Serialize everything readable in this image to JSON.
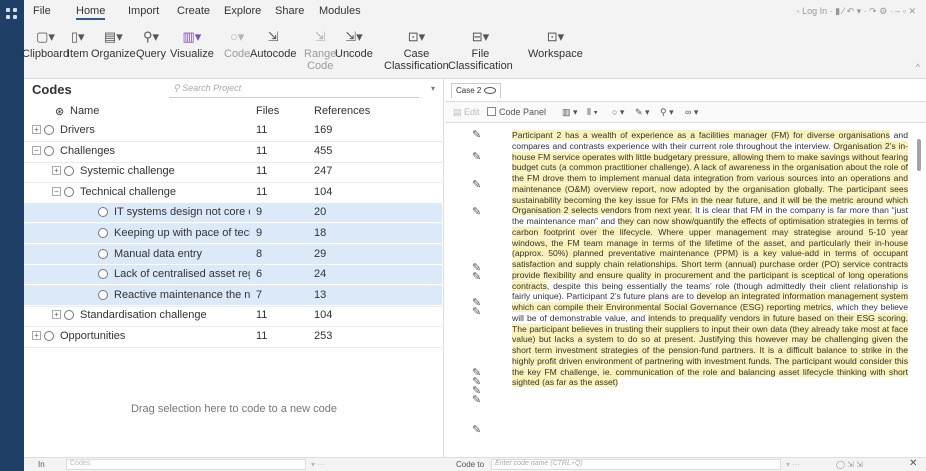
{
  "ribbon": {
    "tabs": [
      "File",
      "Home",
      "Import",
      "Create",
      "Explore",
      "Share",
      "Modules"
    ],
    "active_tab": "Home",
    "right_info": "Log In",
    "tools": [
      {
        "label": "Clipboard",
        "icon": "clipboard-icon"
      },
      {
        "label": "Item",
        "icon": "item-icon"
      },
      {
        "label": "Organize",
        "icon": "organize-icon"
      },
      {
        "label": "Query",
        "icon": "query-icon"
      },
      {
        "label": "Visualize",
        "icon": "chart-icon"
      },
      {
        "label": "Code",
        "icon": "code-icon"
      },
      {
        "label": "Autocode",
        "icon": "autocode-icon"
      },
      {
        "label": "Range",
        "label2": "Code",
        "icon": "range-code-icon"
      },
      {
        "label": "Uncode",
        "icon": "uncode-icon"
      },
      {
        "label": "Case",
        "label2": "Classification",
        "icon": "case-classification-icon"
      },
      {
        "label": "File",
        "label2": "Classification",
        "icon": "file-classification-icon"
      },
      {
        "label": "Workspace",
        "icon": "workspace-icon"
      }
    ]
  },
  "codes": {
    "title": "Codes",
    "search_placeholder": "Search Project",
    "columns": {
      "name": "Name",
      "files": "Files",
      "references": "References"
    },
    "rows": [
      {
        "name": "Drivers",
        "files": "11",
        "refs": "169",
        "level": 0,
        "expander": "+",
        "selected": false
      },
      {
        "name": "Challenges",
        "files": "11",
        "refs": "455",
        "level": 0,
        "expander": "−",
        "selected": false
      },
      {
        "name": "Systemic challenge",
        "files": "11",
        "refs": "247",
        "level": 1,
        "expander": "+",
        "selected": false
      },
      {
        "name": "Technical challenge",
        "files": "11",
        "refs": "104",
        "level": 1,
        "expander": "−",
        "selected": false
      },
      {
        "name": "IT systems design not core co",
        "files": "9",
        "refs": "20",
        "level": 2,
        "expander": "",
        "selected": true
      },
      {
        "name": "Keeping up with pace of tech",
        "files": "9",
        "refs": "18",
        "level": 2,
        "expander": "",
        "selected": true
      },
      {
        "name": "Manual data entry",
        "files": "8",
        "refs": "29",
        "level": 2,
        "expander": "",
        "selected": true
      },
      {
        "name": "Lack of centralised asset regis",
        "files": "6",
        "refs": "24",
        "level": 2,
        "expander": "",
        "selected": true
      },
      {
        "name": "Reactive maintenance the nor",
        "files": "7",
        "refs": "13",
        "level": 2,
        "expander": "",
        "selected": true
      },
      {
        "name": "Standardisation challenge",
        "files": "11",
        "refs": "104",
        "level": 1,
        "expander": "+",
        "selected": false
      },
      {
        "name": "Opportunities",
        "files": "11",
        "refs": "253",
        "level": 0,
        "expander": "+",
        "selected": false
      }
    ],
    "drag_hint": "Drag selection here to code to a new code"
  },
  "document": {
    "tab_label": "Case 2",
    "toolbar": {
      "edit": "Edit",
      "code_panel": "Code Panel"
    },
    "segments": [
      {
        "t": "Participant 2 has a wealth of experience as a facilities manager (FM) for diverse organisations",
        "h": true
      },
      {
        "t": " and compares and contrasts experience with their current role throughout the interview. ",
        "h": false
      },
      {
        "t": "Organisation 2’s in-house FM service operates with little budgetary pressure, allowing them to make savings without fearing budget cuts (a common practitioner challenge). A lack of awareness in the organisation about the role of the FM drove them to implement manual data integration from various sources into an operations and maintenance (O&M) overview report, now adopted by the organisation globally.",
        "h": true
      },
      {
        "t": " The participant sees sustainability becoming the key issue for FMs in the near future, and it will be the metric around which Organisation 2 selects vendors from next year.",
        "h": true
      },
      {
        "t": " It is clear that FM in the company is far more than “just the maintenance man” and ",
        "h": false
      },
      {
        "t": "they can now show/quantify the effects of optimisation strategies in terms of carbon footprint over the lifecycle.",
        "h": true
      },
      {
        "t": " Where upper management may strategise around 5-10 year windows, the FM team manage in terms of the lifetime of the asset, and particularly their in-house (approx. 50%) planned preventative maintenance (PPM) is a key value-add in terms of occupant satisfaction and supply chain relationships.",
        "h": true
      },
      {
        "t": " Short term (annual) purchase order (PO) service contracts provide flexibility and ensure quality in procurement and the participant is sceptical of long operations contracts",
        "h": true
      },
      {
        "t": ", despite this being essentially the teams’ role (though admittedly their client relationship is fairly unique). Participant 2’s future plans are to ",
        "h": false
      },
      {
        "t": "develop an integrated information management system which can compile their Environmental Social Governance (ESG) reporting metrics",
        "h": true
      },
      {
        "t": ", which they believe will be of demonstrable value, and ",
        "h": false
      },
      {
        "t": "intends to prequalify vendors in future based on their ESG scoring.",
        "h": true
      },
      {
        "t": " The participant believes in trusting their suppliers to input their own data (they already take most at face value) but lacks a system to do so at present. Justifying this however may be challenging given the short term investment strategies of the pension-fund partners. It is a difficult balance to strike in the highly profit driven environment of partnering with investment funds.",
        "h": true
      },
      {
        "t": " The participant would consider this the key FM challenge, ie. communication of the role and balancing asset lifecycle thinking with short sighted (as far as the asset)",
        "h": true
      }
    ]
  },
  "bottom": {
    "in_label": "In",
    "in_value": "Codes",
    "code_to_label": "Code to",
    "code_to_placeholder": "Enter code name (CTRL+Q)"
  }
}
